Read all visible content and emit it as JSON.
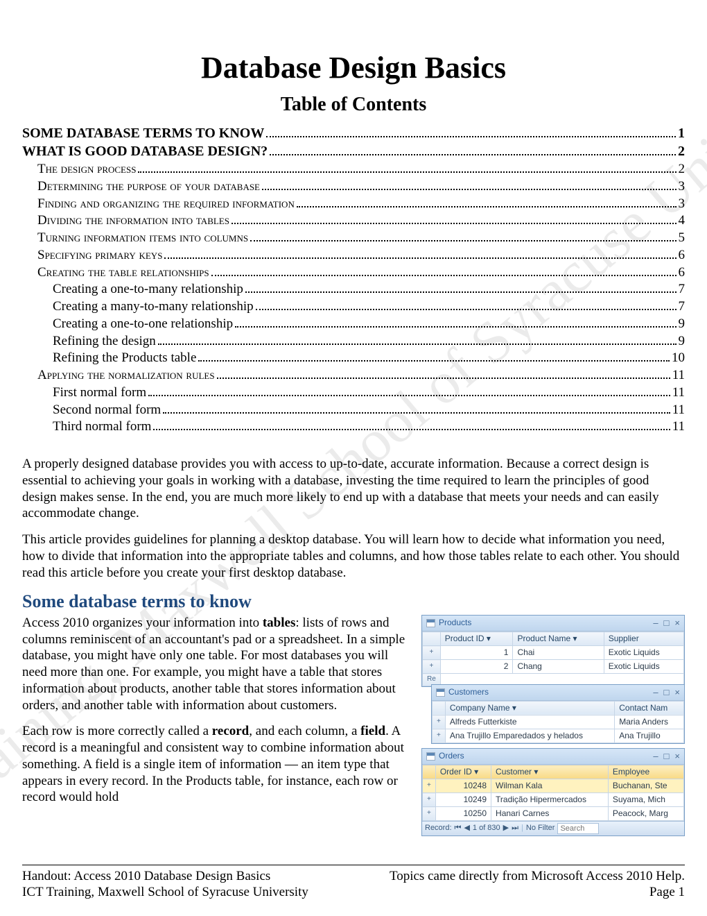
{
  "watermark": "ICT Training, Maxwell School of Syracuse University",
  "title": "Database Design Basics",
  "subtitle": "Table of Contents",
  "toc": [
    {
      "level": 1,
      "label": "SOME DATABASE TERMS TO KNOW",
      "page": "1"
    },
    {
      "level": 1,
      "label": "WHAT IS GOOD DATABASE DESIGN?",
      "page": "2"
    },
    {
      "level": 2,
      "label": "The design process",
      "page": "2"
    },
    {
      "level": 2,
      "label": "Determining the purpose of your database",
      "page": "3"
    },
    {
      "level": 2,
      "label": "Finding and organizing the required information",
      "page": "3"
    },
    {
      "level": 2,
      "label": "Dividing the information into tables",
      "page": "4"
    },
    {
      "level": 2,
      "label": "Turning information items into columns",
      "page": "5"
    },
    {
      "level": 2,
      "label": "Specifying primary keys",
      "page": "6"
    },
    {
      "level": 2,
      "label": "Creating the table relationships",
      "page": "6"
    },
    {
      "level": 3,
      "label": "Creating a one-to-many relationship",
      "page": "7"
    },
    {
      "level": 3,
      "label": "Creating a many-to-many relationship",
      "page": "7"
    },
    {
      "level": 3,
      "label": "Creating a one-to-one relationship",
      "page": "9"
    },
    {
      "level": 3,
      "label": "Refining the design",
      "page": "9"
    },
    {
      "level": 3,
      "label": "Refining the Products table",
      "page": "10"
    },
    {
      "level": 2,
      "label": "Applying the normalization rules",
      "page": "11"
    },
    {
      "level": 3,
      "label": "First normal form",
      "page": "11"
    },
    {
      "level": 3,
      "label": "Second normal form",
      "page": "11"
    },
    {
      "level": 3,
      "label": "Third normal form",
      "page": "11"
    }
  ],
  "para1": "A properly designed database provides you with access to up-to-date, accurate information. Because a correct design is essential to achieving your goals in working with a database, investing the time required to learn the principles of good design makes sense. In the end, you are much more likely to end up with a database that meets your needs and can easily accommodate change.",
  "para2": "This article provides guidelines for planning a desktop database. You will learn how to decide what information you need, how to divide that information into the appropriate tables and columns, and how those tables relate to each other. You should read this article before you create your first desktop database.",
  "section1": "Some database terms to know",
  "para3a": "Access 2010 organizes your information into ",
  "para3b": "tables",
  "para3c": ": lists of rows and columns reminiscent of an accountant's pad or a spreadsheet. In a simple database, you might have only one table. For most databases you will need more than one. For example, you might have a table that stores information about products, another table that stores information about orders, and another table with information about customers.",
  "para4a": "Each row is more correctly called a ",
  "para4b": "record",
  "para4c": ", and each column, a ",
  "para4d": "field",
  "para4e": ". A record is a meaningful and consistent way to combine information about something. A field is a single item of information — an item type that appears in every record. In the Products table, for instance, each row or record would hold",
  "products": {
    "title": "Products",
    "cols": [
      "Product ID ▾",
      "Product Name ▾",
      "Supplier"
    ],
    "rows": [
      {
        "id": "1",
        "name": "Chai",
        "supp": "Exotic Liquids"
      },
      {
        "id": "2",
        "name": "Chang",
        "supp": "Exotic Liquids"
      }
    ],
    "re": "Re"
  },
  "customers": {
    "title": "Customers",
    "cols": [
      "Company Name ▾",
      "Contact Nam"
    ],
    "rows": [
      {
        "company": "Alfreds Futterkiste",
        "contact": "Maria Anders"
      },
      {
        "company": "Ana Trujillo Emparedados y helados",
        "contact": "Ana Trujillo"
      }
    ]
  },
  "orders": {
    "title": "Orders",
    "cols": [
      "Order ID ▾",
      "Customer ▾",
      "Employee"
    ],
    "rows": [
      {
        "id": "10248",
        "cust": "Wilman Kala",
        "emp": "Buchanan, Ste"
      },
      {
        "id": "10249",
        "cust": "Tradição Hipermercados",
        "emp": "Suyama, Mich"
      },
      {
        "id": "10250",
        "cust": "Hanari Carnes",
        "emp": "Peacock, Marg"
      }
    ],
    "nav": {
      "label": "Record:",
      "pos": "1 of 830",
      "filter": "No Filter",
      "search": "Search"
    }
  },
  "winbtns": {
    "min": "–",
    "max": "□",
    "close": "×"
  },
  "footer": {
    "left1": "Handout: Access 2010 Database Design Basics",
    "right1": "Topics came directly from Microsoft Access 2010 Help.",
    "left2": "ICT Training, Maxwell School of Syracuse University",
    "right2": "Page 1"
  }
}
